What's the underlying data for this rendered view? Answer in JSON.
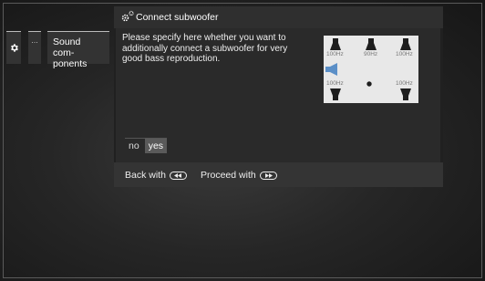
{
  "breadcrumb": {
    "settings_icon": "gear-icon",
    "more_label": "...",
    "sound_label": "Sound com-ponents"
  },
  "dialog": {
    "title": "Connect subwoofer",
    "title_icon": "gears-icon",
    "description": "Please specify here whether you want to additionally connect a subwoofer for very good bass reproduction.",
    "speaker_labels": {
      "front_left": "100Hz",
      "center": "90Hz",
      "front_right": "100Hz",
      "rear_left": "100Hz",
      "rear_right": "100Hz"
    },
    "options": {
      "no": "no",
      "yes": "yes",
      "selected": "yes"
    }
  },
  "footer": {
    "back_label": "Back with",
    "proceed_label": "Proceed with",
    "back_key_icon": "rewind-key-icon",
    "proceed_key_icon": "forward-key-icon"
  },
  "colors": {
    "subwoofer_highlight": "#5b8fc7",
    "speaker_dark": "#1e1e1e",
    "panel_bg": "#e8e8e8"
  }
}
